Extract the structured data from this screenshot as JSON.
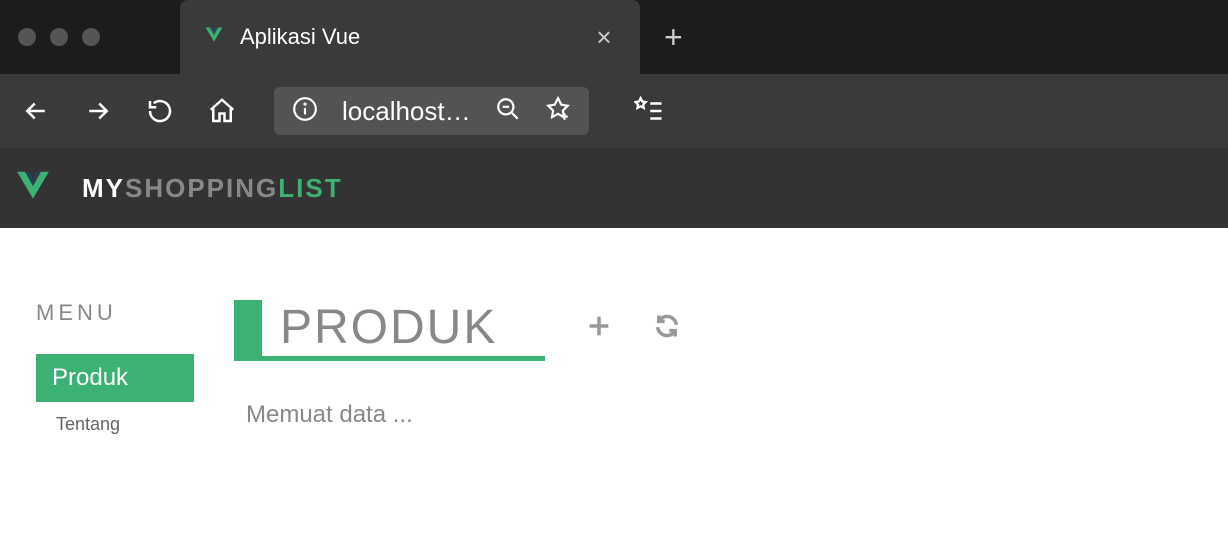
{
  "browser": {
    "tab_title": "Aplikasi Vue",
    "url": "localhost…"
  },
  "header": {
    "brand_part1": "MY",
    "brand_part2": "SHOPPING",
    "brand_part3": "LIST"
  },
  "sidebar": {
    "heading": "MENU",
    "items": [
      {
        "label": "Produk",
        "active": true
      },
      {
        "label": "Tentang",
        "active": false
      }
    ]
  },
  "main": {
    "title": "PRODUK",
    "loading_text": "Memuat data ..."
  }
}
